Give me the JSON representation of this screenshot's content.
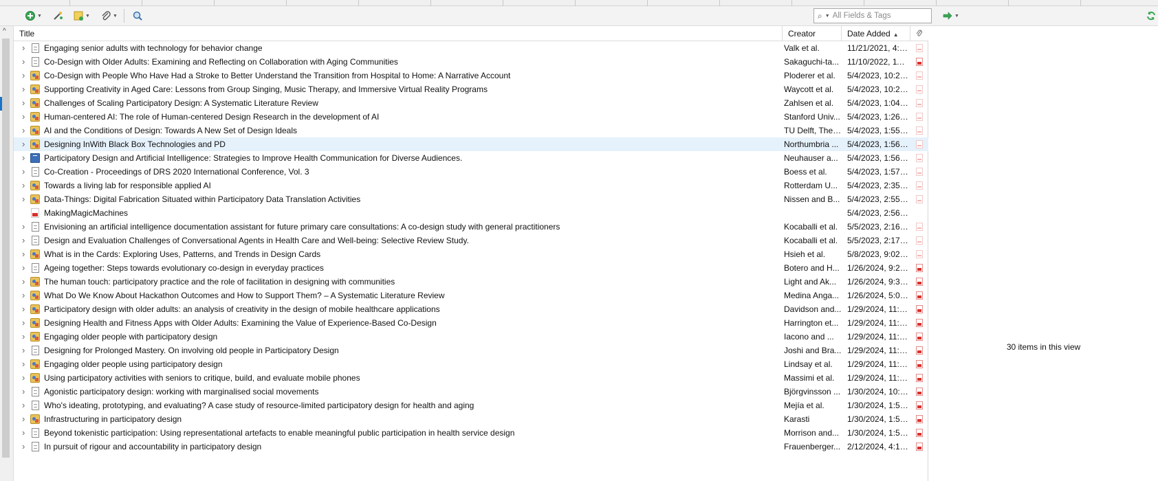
{
  "toolbar": {
    "new_item_icon": "plus-circle-icon",
    "add_by_identifier_icon": "magic-wand-icon",
    "new_note_icon": "note-icon",
    "add_attachment_icon": "paperclip-icon",
    "advanced_search_icon": "magnifier-icon",
    "search": {
      "mode_icon": "search-icon",
      "placeholder": "All Fields & Tags",
      "value": ""
    },
    "locate_icon": "arrow-right-icon",
    "sync_icon": "sync-icon"
  },
  "columns": {
    "title": "Title",
    "creator": "Creator",
    "date_added": "Date Added",
    "attachments_icon": "paperclip-icon",
    "sort": "ascending"
  },
  "items": [
    {
      "type": "document",
      "title": "Engaging senior adults with technology for behavior change",
      "creator": "Valk et al.",
      "date": "11/21/2021, 4:2...",
      "attachment": "faint",
      "expandable": true
    },
    {
      "type": "document",
      "title": "Co-Design with Older Adults: Examining and Reflecting on Collaboration with Aging Communities",
      "creator": "Sakaguchi-ta...",
      "date": "11/10/2022, 11:...",
      "attachment": "pdf",
      "expandable": true
    },
    {
      "type": "conference",
      "title": "Co-Design with People Who Have Had a Stroke to Better Understand the Transition from Hospital to Home: A Narrative Account",
      "creator": "Ploderer et al.",
      "date": "5/4/2023, 10:23...",
      "attachment": "faint",
      "expandable": true
    },
    {
      "type": "conference",
      "title": "Supporting Creativity in Aged Care: Lessons from Group Singing, Music Therapy, and Immersive Virtual Reality Programs",
      "creator": "Waycott et al.",
      "date": "5/4/2023, 10:24...",
      "attachment": "faint",
      "expandable": true
    },
    {
      "type": "conference",
      "title": "Challenges of Scaling Participatory Design: A Systematic Literature Review",
      "creator": "Zahlsen et al.",
      "date": "5/4/2023, 1:04:...",
      "attachment": "faint",
      "expandable": true
    },
    {
      "type": "conference",
      "title": "Human-centered AI: The role of Human-centered Design Research in the development of AI",
      "creator": "Stanford Univ...",
      "date": "5/4/2023, 1:26:...",
      "attachment": "faint",
      "expandable": true
    },
    {
      "type": "conference",
      "title": "AI and the Conditions of Design: Towards A New Set of Design Ideals",
      "creator": "TU Delft, The ...",
      "date": "5/4/2023, 1:55:...",
      "attachment": "faint",
      "expandable": true
    },
    {
      "type": "conference",
      "title": "Designing InWith Black Box Technologies and PD",
      "creator": "Northumbria ...",
      "date": "5/4/2023, 1:56:...",
      "attachment": "faint",
      "expandable": true,
      "selected": true
    },
    {
      "type": "book",
      "title": "Participatory Design and Artificial Intelligence: Strategies to Improve Health Communication for Diverse Audiences.",
      "creator": "Neuhauser a...",
      "date": "5/4/2023, 1:56:...",
      "attachment": "faint",
      "expandable": true
    },
    {
      "type": "document",
      "title": "Co-Creation - Proceedings of DRS 2020 International Conference, Vol. 3",
      "creator": "Boess et al.",
      "date": "5/4/2023, 1:57:...",
      "attachment": "faint",
      "expandable": true
    },
    {
      "type": "conference",
      "title": "Towards a living lab for responsible applied AI",
      "creator": "Rotterdam U...",
      "date": "5/4/2023, 2:35:...",
      "attachment": "faint",
      "expandable": true
    },
    {
      "type": "conference",
      "title": "Data-Things: Digital Fabrication Situated within Participatory Data Translation Activities",
      "creator": "Nissen and B...",
      "date": "5/4/2023, 2:55:...",
      "attachment": "faint",
      "expandable": true
    },
    {
      "type": "pdf",
      "title": "MakingMagicMachines",
      "creator": "",
      "date": "5/4/2023, 2:56:...",
      "attachment": "none",
      "expandable": false
    },
    {
      "type": "document",
      "title": "Envisioning an artificial intelligence documentation assistant for future primary care consultations: A co-design study with general practitioners",
      "creator": "Kocaballi et al.",
      "date": "5/5/2023, 2:16:...",
      "attachment": "faint",
      "expandable": true
    },
    {
      "type": "document",
      "title": "Design and Evaluation Challenges of Conversational Agents in Health Care and Well-being: Selective Review Study.",
      "creator": "Kocaballi et al.",
      "date": "5/5/2023, 2:17:...",
      "attachment": "faint",
      "expandable": true
    },
    {
      "type": "conference",
      "title": "What is in the Cards: Exploring Uses, Patterns, and Trends in Design Cards",
      "creator": "Hsieh et al.",
      "date": "5/8/2023, 9:02:...",
      "attachment": "faint",
      "expandable": true
    },
    {
      "type": "document",
      "title": "Ageing together: Steps towards evolutionary co-design in everyday practices",
      "creator": "Botero and H...",
      "date": "1/26/2024, 9:24...",
      "attachment": "pdf",
      "expandable": true
    },
    {
      "type": "conference",
      "title": "The human touch: participatory practice and the role of facilitation in designing with communities",
      "creator": "Light and Ak...",
      "date": "1/26/2024, 9:35...",
      "attachment": "pdf",
      "expandable": true
    },
    {
      "type": "conference",
      "title": "What Do We Know About Hackathon Outcomes and How to Support Them? – A Systematic Literature Review",
      "creator": "Medina Anga...",
      "date": "1/26/2024, 5:08...",
      "attachment": "pdf",
      "expandable": true
    },
    {
      "type": "conference",
      "title": "Participatory design with older adults: an analysis of creativity in the design of mobile healthcare applications",
      "creator": "Davidson and...",
      "date": "1/29/2024, 11:4...",
      "attachment": "pdf",
      "expandable": true
    },
    {
      "type": "conference",
      "title": "Designing Health and Fitness Apps with Older Adults: Examining the Value of Experience-Based Co-Design",
      "creator": "Harrington et...",
      "date": "1/29/2024, 11:4...",
      "attachment": "pdf",
      "expandable": true
    },
    {
      "type": "conference",
      "title": "Engaging older people with participatory design",
      "creator": "Iacono and ...",
      "date": "1/29/2024, 11:5...",
      "attachment": "pdf",
      "expandable": true
    },
    {
      "type": "document",
      "title": "Designing for Prolonged Mastery. On involving old people in Participatory Design",
      "creator": "Joshi and Bra...",
      "date": "1/29/2024, 11:5...",
      "attachment": "pdf",
      "expandable": true
    },
    {
      "type": "conference",
      "title": "Engaging older people using participatory design",
      "creator": "Lindsay et al.",
      "date": "1/29/2024, 11:5...",
      "attachment": "pdf",
      "expandable": true
    },
    {
      "type": "conference",
      "title": "Using participatory activities with seniors to critique, build, and evaluate mobile phones",
      "creator": "Massimi et al.",
      "date": "1/29/2024, 11:5...",
      "attachment": "pdf",
      "expandable": true
    },
    {
      "type": "document",
      "title": "Agonistic participatory design: working with marginalised social movements",
      "creator": "Björgvinsson ...",
      "date": "1/30/2024, 10:4...",
      "attachment": "pdf",
      "expandable": true
    },
    {
      "type": "document",
      "title": "Who's ideating, prototyping, and evaluating? A case study of resource-limited participatory design for health and aging",
      "creator": "Mejía et al.",
      "date": "1/30/2024, 1:52...",
      "attachment": "pdf",
      "expandable": true
    },
    {
      "type": "conference",
      "title": "Infrastructuring in participatory design",
      "creator": "Karasti",
      "date": "1/30/2024, 1:52...",
      "attachment": "pdf",
      "expandable": true
    },
    {
      "type": "document",
      "title": "Beyond tokenistic participation: Using representational artefacts to enable meaningful public participation in health service design",
      "creator": "Morrison and...",
      "date": "1/30/2024, 1:54...",
      "attachment": "pdf",
      "expandable": true
    },
    {
      "type": "document",
      "title": "In pursuit of rigour and accountability in participatory design",
      "creator": "Frauenberger...",
      "date": "2/12/2024, 4:14...",
      "attachment": "pdf",
      "expandable": true
    }
  ],
  "right_pane": {
    "count_text": "30 items in this view"
  },
  "colors": {
    "selection": "#e5f1fb",
    "pdf_red": "#d9302c",
    "accent_green": "#2e9e44"
  }
}
